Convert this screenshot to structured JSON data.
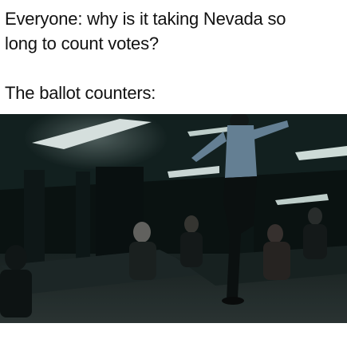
{
  "caption": {
    "line1": "Everyone: why is it taking Nevada so",
    "line2": "long to count votes?",
    "line3": "The ballot counters:"
  },
  "image": {
    "icon": "dark-office-scene-man-standing-on-desk",
    "colors": {
      "background": "#0b1413",
      "ceiling": "#1a2a2a",
      "light": "#e8f2f0",
      "floor": "#2a3433"
    }
  }
}
